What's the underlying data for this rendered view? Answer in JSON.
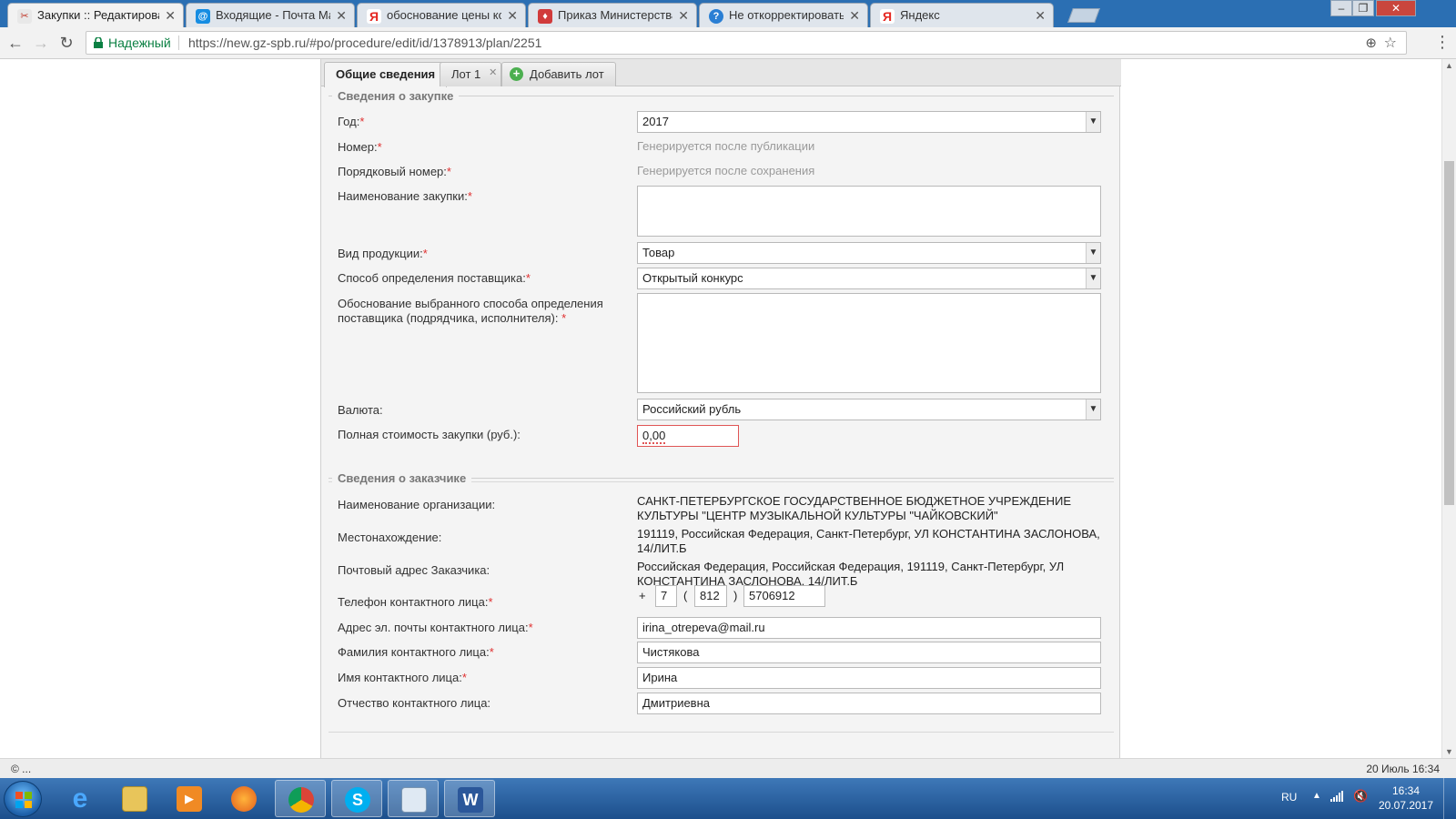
{
  "browser": {
    "tabs": [
      {
        "title": "Закупки :: Редактирован",
        "active": true,
        "icon": "procurement-icon"
      },
      {
        "title": "Входящие - Почта Mail.R",
        "active": false,
        "icon": "mail-icon"
      },
      {
        "title": "обоснование цены конт",
        "active": false,
        "icon": "yandex-icon"
      },
      {
        "title": "Приказ Министерства э",
        "active": false,
        "icon": "ministry-icon"
      },
      {
        "title": "Не откорректировать з",
        "active": false,
        "icon": "info-icon"
      },
      {
        "title": "Яндекс",
        "active": false,
        "icon": "yandex-icon"
      }
    ],
    "secure_label": "Надежный",
    "url": "https://new.gz-spb.ru/#po/procedure/edit/id/1378913/plan/2251"
  },
  "form_tabs": {
    "general": "Общие сведения",
    "lot1": "Лот 1",
    "add_lot": "Добавить лот"
  },
  "purchase": {
    "legend": "Сведения о закупке",
    "year_label": "Год:",
    "year_value": "2017",
    "number_label": "Номер:",
    "number_value": "Генерируется после публикации",
    "seq_label": "Порядковый номер:",
    "seq_value": "Генерируется после сохранения",
    "name_label": "Наименование закупки:",
    "name_value": "",
    "product_label": "Вид продукции:",
    "product_value": "Товар",
    "method_label": "Способ определения поставщика:",
    "method_value": "Открытый конкурс",
    "justification_label_1": "Обоснование выбранного способа определения",
    "justification_label_2": "поставщика (подрядчика, исполнителя):",
    "justification_value": "",
    "currency_label": "Валюта:",
    "currency_value": "Российский рубль",
    "cost_label": "Полная стоимость закупки (руб.):",
    "cost_value": "0,00",
    "required_mark": "*"
  },
  "customer": {
    "legend": "Сведения о заказчике",
    "org_label": "Наименование организации:",
    "org_value": "САНКТ-ПЕТЕРБУРГСКОЕ ГОСУДАРСТВЕННОЕ БЮДЖЕТНОЕ УЧРЕЖДЕНИЕ КУЛЬТУРЫ \"ЦЕНТР МУЗЫКАЛЬНОЙ КУЛЬТУРЫ \"ЧАЙКОВСКИЙ\"",
    "location_label": "Местонахождение:",
    "location_value": "191119, Российская Федерация, Санкт-Петербург, УЛ КОНСТАНТИНА ЗАСЛОНОВА, 14/ЛИТ.Б",
    "postal_label": "Почтовый адрес Заказчика:",
    "postal_value": "Российская Федерация, Российская Федерация, 191119, Санкт-Петербург, УЛ КОНСТАНТИНА ЗАСЛОНОВА, 14/ЛИТ.Б",
    "phone_label": "Телефон контактного лица:",
    "phone_plus": "+",
    "phone_country": "7",
    "phone_paren_open": "(",
    "phone_code": "812",
    "phone_paren_close": ")",
    "phone_number": "5706912",
    "email_label": "Адрес эл. почты контактного лица:",
    "email_value": "irina_otrepeva@mail.ru",
    "lastname_label": "Фамилия контактного лица:",
    "lastname_value": "Чистякова",
    "firstname_label": "Имя контактного лица:",
    "firstname_value": "Ирина",
    "patronymic_label": "Отчество контактного лица:",
    "patronymic_value": "Дмитриевна"
  },
  "status_bar": {
    "left": "© ...",
    "right": "20 Июль 16:34"
  },
  "taskbar": {
    "apps": [
      "internet-explorer-icon",
      "file-explorer-icon",
      "media-player-icon",
      "firefox-icon",
      "chrome-icon",
      "skype-icon",
      "notepad-icon",
      "word-icon"
    ],
    "lang": "RU",
    "time": "16:34",
    "date": "20.07.2017"
  },
  "colors": {
    "accent_blue": "#2b6fb3",
    "required_red": "#e03030",
    "secure_green": "#0b8043",
    "invalid_border": "#e05555"
  }
}
